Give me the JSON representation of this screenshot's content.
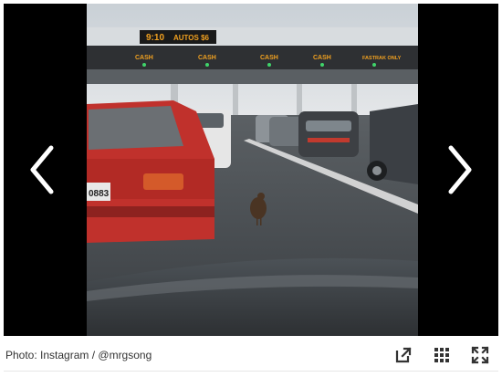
{
  "gallery": {
    "caption": "Photo: Instagram / @mrgsong",
    "prev_icon": "chevron-left-icon",
    "next_icon": "chevron-right-icon",
    "tools": [
      "share-external-icon",
      "grid-view-icon",
      "fullscreen-icon"
    ]
  },
  "photo": {
    "sign_time": "9:10",
    "sign_toll": "AUTOS $6",
    "lane_labels": [
      "CASH",
      "CASH",
      "CASH",
      "CASH",
      "FASTRAK ONLY"
    ],
    "plate": "0883"
  },
  "colors": {
    "background": "#000000",
    "icon": "#ffffff",
    "toolbar_icon": "#333333"
  }
}
